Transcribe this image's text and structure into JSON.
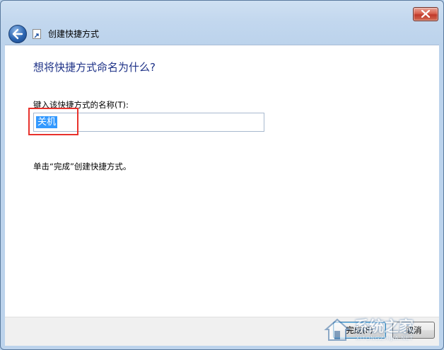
{
  "window": {
    "title": "创建快捷方式"
  },
  "page": {
    "heading": "想将快捷方式命名为什么?",
    "field_label": "键入该快捷方式的名称(T):",
    "name_value": "关机",
    "hint": "单击“完成”创建快捷方式。"
  },
  "footer": {
    "finish_label": "完成(F)",
    "cancel_label": "取消"
  },
  "watermark": {
    "text": "系统之家",
    "sub": "XITONGZHIJIA.NET"
  },
  "icons": [
    "close-icon",
    "back-arrow-icon",
    "shortcut-arrow-icon"
  ],
  "colors": {
    "heading": "#1e3287",
    "selection": "#3399ff",
    "highlight_box": "#e8322c",
    "close_button": "#c0392b"
  }
}
